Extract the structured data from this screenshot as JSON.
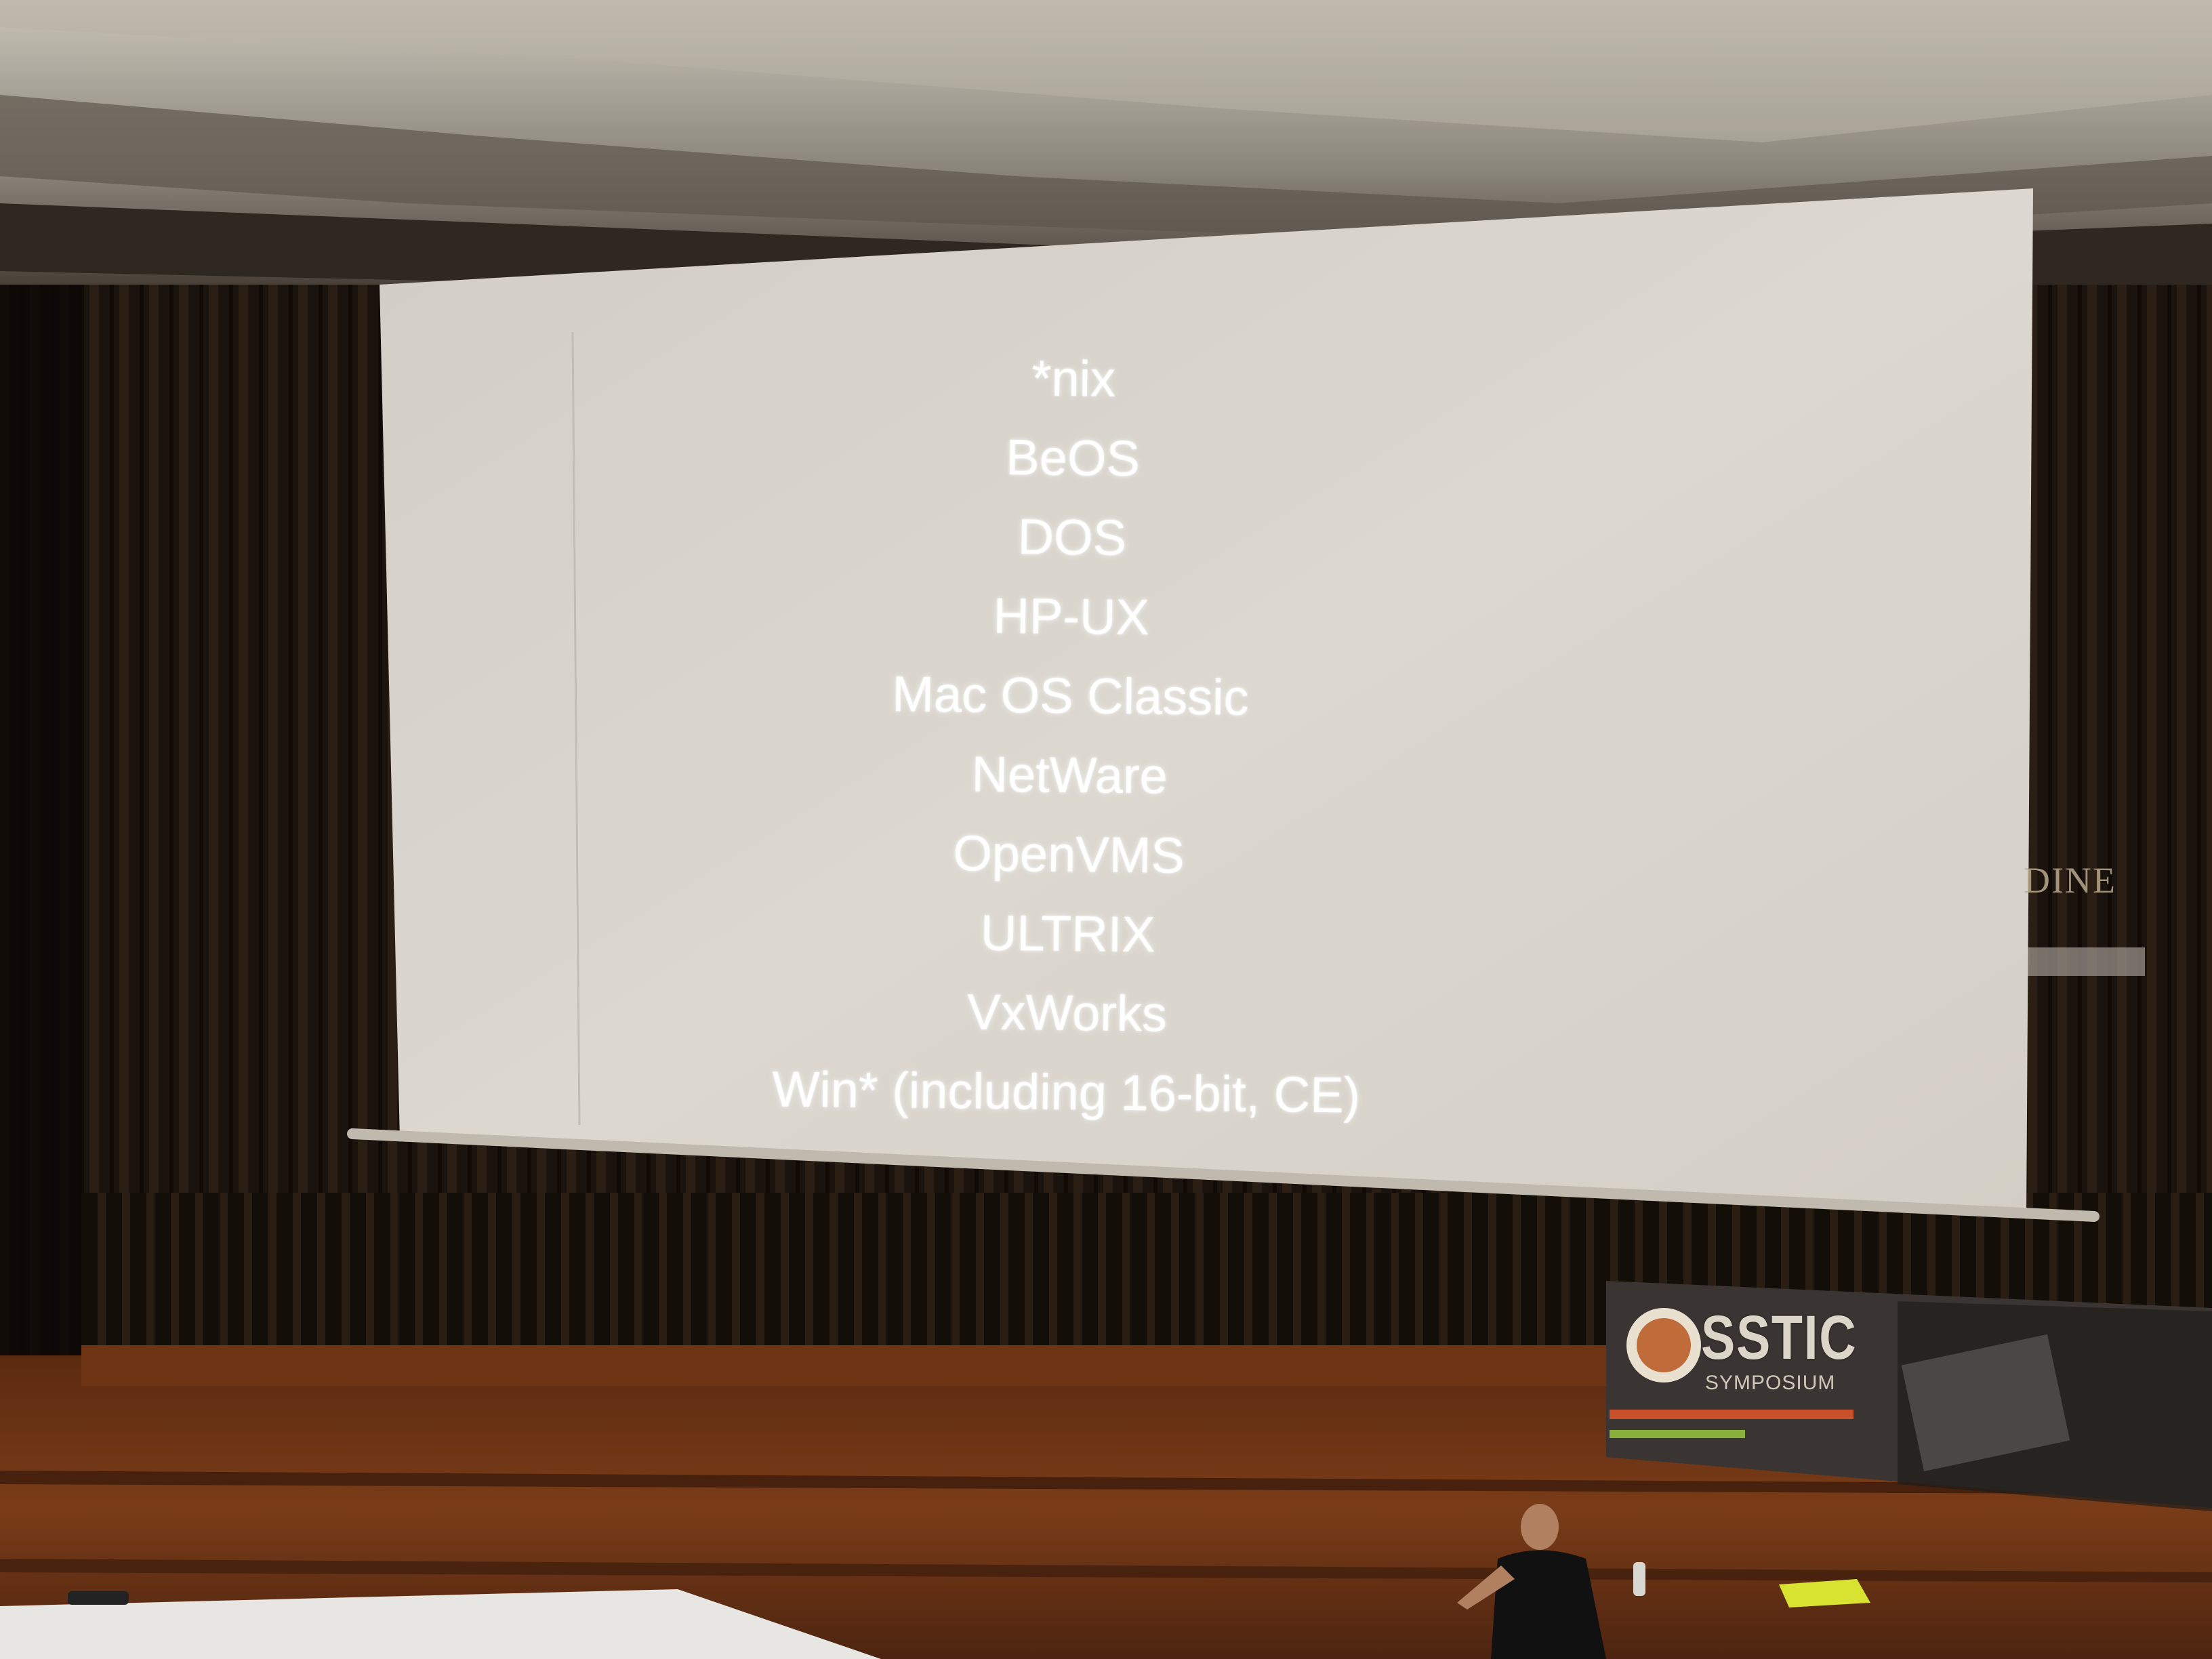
{
  "slide": {
    "items": [
      "*nix",
      "BeOS",
      "DOS",
      "HP-UX",
      "Mac OS Classic",
      "NetWare",
      "OpenVMS",
      "ULTRIX",
      "VxWorks",
      "Win* (including 16-bit, CE)"
    ]
  },
  "wall_sign": {
    "text": "DINE"
  },
  "banner": {
    "title": "SSTIC",
    "subtitle": "SYMPOSIUM"
  },
  "colors": {
    "screen": "#d8d4cc",
    "wall": "#1a120c",
    "ceiling": "#8f8a80",
    "stage": "#6a3416"
  }
}
